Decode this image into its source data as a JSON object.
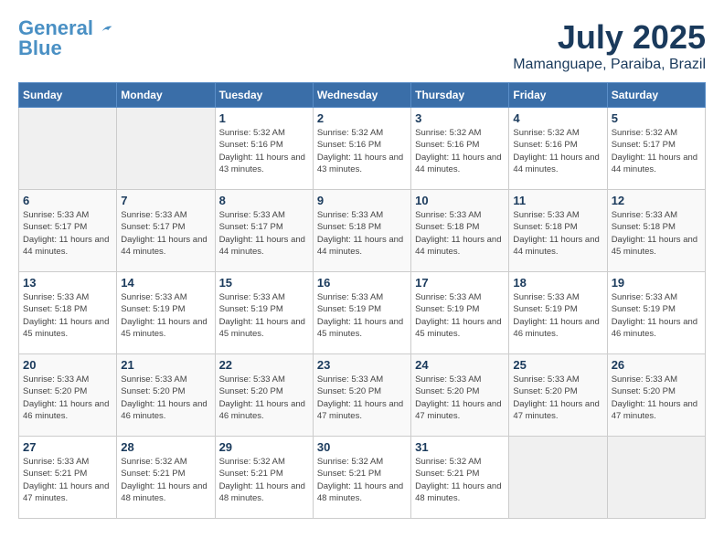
{
  "header": {
    "logo_general": "General",
    "logo_blue": "Blue",
    "month_year": "July 2025",
    "location": "Mamanguape, Paraiba, Brazil"
  },
  "days_of_week": [
    "Sunday",
    "Monday",
    "Tuesday",
    "Wednesday",
    "Thursday",
    "Friday",
    "Saturday"
  ],
  "weeks": [
    [
      {
        "day": "",
        "info": ""
      },
      {
        "day": "",
        "info": ""
      },
      {
        "day": "1",
        "info": "Sunrise: 5:32 AM\nSunset: 5:16 PM\nDaylight: 11 hours and 43 minutes."
      },
      {
        "day": "2",
        "info": "Sunrise: 5:32 AM\nSunset: 5:16 PM\nDaylight: 11 hours and 43 minutes."
      },
      {
        "day": "3",
        "info": "Sunrise: 5:32 AM\nSunset: 5:16 PM\nDaylight: 11 hours and 44 minutes."
      },
      {
        "day": "4",
        "info": "Sunrise: 5:32 AM\nSunset: 5:16 PM\nDaylight: 11 hours and 44 minutes."
      },
      {
        "day": "5",
        "info": "Sunrise: 5:32 AM\nSunset: 5:17 PM\nDaylight: 11 hours and 44 minutes."
      }
    ],
    [
      {
        "day": "6",
        "info": "Sunrise: 5:33 AM\nSunset: 5:17 PM\nDaylight: 11 hours and 44 minutes."
      },
      {
        "day": "7",
        "info": "Sunrise: 5:33 AM\nSunset: 5:17 PM\nDaylight: 11 hours and 44 minutes."
      },
      {
        "day": "8",
        "info": "Sunrise: 5:33 AM\nSunset: 5:17 PM\nDaylight: 11 hours and 44 minutes."
      },
      {
        "day": "9",
        "info": "Sunrise: 5:33 AM\nSunset: 5:18 PM\nDaylight: 11 hours and 44 minutes."
      },
      {
        "day": "10",
        "info": "Sunrise: 5:33 AM\nSunset: 5:18 PM\nDaylight: 11 hours and 44 minutes."
      },
      {
        "day": "11",
        "info": "Sunrise: 5:33 AM\nSunset: 5:18 PM\nDaylight: 11 hours and 44 minutes."
      },
      {
        "day": "12",
        "info": "Sunrise: 5:33 AM\nSunset: 5:18 PM\nDaylight: 11 hours and 45 minutes."
      }
    ],
    [
      {
        "day": "13",
        "info": "Sunrise: 5:33 AM\nSunset: 5:18 PM\nDaylight: 11 hours and 45 minutes."
      },
      {
        "day": "14",
        "info": "Sunrise: 5:33 AM\nSunset: 5:19 PM\nDaylight: 11 hours and 45 minutes."
      },
      {
        "day": "15",
        "info": "Sunrise: 5:33 AM\nSunset: 5:19 PM\nDaylight: 11 hours and 45 minutes."
      },
      {
        "day": "16",
        "info": "Sunrise: 5:33 AM\nSunset: 5:19 PM\nDaylight: 11 hours and 45 minutes."
      },
      {
        "day": "17",
        "info": "Sunrise: 5:33 AM\nSunset: 5:19 PM\nDaylight: 11 hours and 45 minutes."
      },
      {
        "day": "18",
        "info": "Sunrise: 5:33 AM\nSunset: 5:19 PM\nDaylight: 11 hours and 46 minutes."
      },
      {
        "day": "19",
        "info": "Sunrise: 5:33 AM\nSunset: 5:19 PM\nDaylight: 11 hours and 46 minutes."
      }
    ],
    [
      {
        "day": "20",
        "info": "Sunrise: 5:33 AM\nSunset: 5:20 PM\nDaylight: 11 hours and 46 minutes."
      },
      {
        "day": "21",
        "info": "Sunrise: 5:33 AM\nSunset: 5:20 PM\nDaylight: 11 hours and 46 minutes."
      },
      {
        "day": "22",
        "info": "Sunrise: 5:33 AM\nSunset: 5:20 PM\nDaylight: 11 hours and 46 minutes."
      },
      {
        "day": "23",
        "info": "Sunrise: 5:33 AM\nSunset: 5:20 PM\nDaylight: 11 hours and 47 minutes."
      },
      {
        "day": "24",
        "info": "Sunrise: 5:33 AM\nSunset: 5:20 PM\nDaylight: 11 hours and 47 minutes."
      },
      {
        "day": "25",
        "info": "Sunrise: 5:33 AM\nSunset: 5:20 PM\nDaylight: 11 hours and 47 minutes."
      },
      {
        "day": "26",
        "info": "Sunrise: 5:33 AM\nSunset: 5:20 PM\nDaylight: 11 hours and 47 minutes."
      }
    ],
    [
      {
        "day": "27",
        "info": "Sunrise: 5:33 AM\nSunset: 5:21 PM\nDaylight: 11 hours and 47 minutes."
      },
      {
        "day": "28",
        "info": "Sunrise: 5:32 AM\nSunset: 5:21 PM\nDaylight: 11 hours and 48 minutes."
      },
      {
        "day": "29",
        "info": "Sunrise: 5:32 AM\nSunset: 5:21 PM\nDaylight: 11 hours and 48 minutes."
      },
      {
        "day": "30",
        "info": "Sunrise: 5:32 AM\nSunset: 5:21 PM\nDaylight: 11 hours and 48 minutes."
      },
      {
        "day": "31",
        "info": "Sunrise: 5:32 AM\nSunset: 5:21 PM\nDaylight: 11 hours and 48 minutes."
      },
      {
        "day": "",
        "info": ""
      },
      {
        "day": "",
        "info": ""
      }
    ]
  ]
}
